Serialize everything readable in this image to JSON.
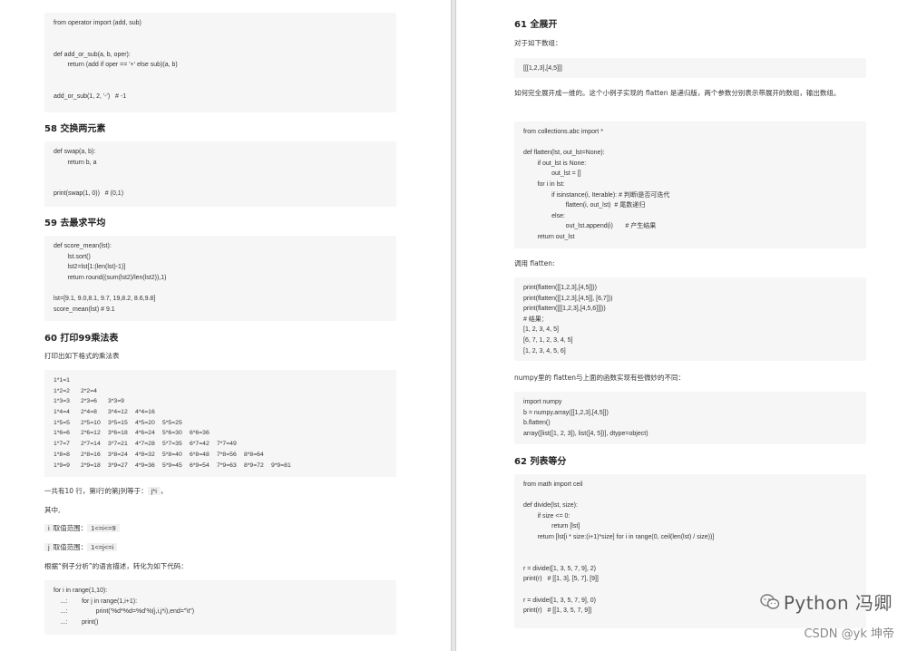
{
  "left": {
    "code_top": [
      "from operator import (add, sub)",
      "",
      "",
      "def add_or_sub(a, b, oper):",
      "        return (add if oper == '+' else sub)(a, b)",
      "",
      "",
      "add_or_sub(1, 2, '-')   # -1"
    ],
    "h58": "58 交换两元素",
    "code58": [
      "def swap(a, b):",
      "        return b, a",
      "",
      "",
      "print(swap(1, 0))   # (0,1)"
    ],
    "h59": "59 去最求平均",
    "code59": [
      "def score_mean(lst):",
      "        lst.sort()",
      "        lst2=lst[1:(len(lst)-1)]",
      "        return round((sum(lst2)/len(lst2)),1)",
      "",
      "lst=[9.1, 9.0,8.1, 9.7, 19,8.2, 8.6,9.8]",
      "score_mean(lst) # 9.1"
    ],
    "h60": "60 打印99乘法表",
    "p60": "打印出如下格式的乘法表",
    "table_rows": [
      [
        "1*1=1"
      ],
      [
        "1*2=2",
        "2*2=4"
      ],
      [
        "1*3=3",
        "2*3=6",
        "3*3=9"
      ],
      [
        "1*4=4",
        "2*4=8",
        "3*4=12",
        "4*4=16"
      ],
      [
        "1*5=5",
        "2*5=10",
        "3*5=15",
        "4*5=20",
        "5*5=25"
      ],
      [
        "1*6=6",
        "2*6=12",
        "3*6=18",
        "4*6=24",
        "5*6=30",
        "6*6=36"
      ],
      [
        "1*7=7",
        "2*7=14",
        "3*7=21",
        "4*7=28",
        "5*7=35",
        "6*7=42",
        "7*7=49"
      ],
      [
        "1*8=8",
        "2*8=16",
        "3*8=24",
        "4*8=32",
        "5*8=40",
        "6*8=48",
        "7*8=56",
        "8*8=64"
      ],
      [
        "1*9=9",
        "2*9=18",
        "3*9=27",
        "4*9=36",
        "5*9=45",
        "6*9=54",
        "7*9=63",
        "8*9=72",
        "9*9=81"
      ]
    ],
    "p_rows_prefix": "一共有10 行，第i行的第j列等于：",
    "p_rows_code": "j*i",
    "p_rows_suffix": "，",
    "p_where": "其中,",
    "p_i_prefix": "i",
    "p_i_mid": "取值范围：",
    "p_i_code": "1<=i<=9",
    "p_j_prefix": "j",
    "p_j_mid": "取值范围：",
    "p_j_code": "1<=j<=i",
    "p_analysis": "根据“例子分析”的语言描述，转化为如下代码：",
    "code_bottom": [
      "for i in range(1,10):",
      "    ...:        for j in range(1,i+1):",
      "    ...:                print('%d*%d=%d'%(j,i,j*i),end=\"\\t\")",
      "    ...:        print()"
    ]
  },
  "right": {
    "h61": "61 全展开",
    "p61a": "对于如下数组：",
    "arr": "[[[1,2,3],[4,5]]]",
    "p61b": "如何完全展开成一维的。这个小例子实现的 flatten 是递归版，两个参数分别表示带展开的数组，输出数组。",
    "code61": [
      "from collections.abc import *",
      "",
      "def flatten(lst, out_lst=None):",
      "        if out_lst is None:",
      "                out_lst = []",
      "        for i in lst:",
      "                if isinstance(i, Iterable): # 判断i是否可迭代",
      "                        flatten(i, out_lst)  # 尾数递归",
      "                else:",
      "                        out_lst.append(i)       # 产生结果",
      "        return out_lst"
    ],
    "p_call": "调用 flatten:",
    "code_call": [
      "print(flatten([[1,2,3],[4,5]]))",
      "print(flatten([[1,2,3],[4,5]], [6,7]))",
      "print(flatten([[[1,2,3],[4,5,6]]]))",
      "# 结果：",
      "[1, 2, 3, 4, 5]",
      "[6, 7, 1, 2, 3, 4, 5]",
      "[1, 2, 3, 4, 5, 6]"
    ],
    "p_numpy": "numpy里的 flatten与上面的函数实现有些微妙的不同：",
    "code_numpy": [
      "import numpy",
      "b = numpy.array([[1,2,3],[4,5]])",
      "b.flatten()",
      "array([list([1, 2, 3]), list([4, 5])], dtype=object)"
    ],
    "h62": "62 列表等分",
    "code62": [
      "from math import ceil",
      "",
      "def divide(lst, size):",
      "        if size <= 0:",
      "                return [lst]",
      "        return [lst[i * size:(i+1)*size] for i in range(0, ceil(len(lst) / size))]",
      "",
      "",
      "r = divide([1, 3, 5, 7, 9], 2)",
      "print(r)   # [[1, 3], [5, 7], [9]]",
      "",
      "r = divide([1, 3, 5, 7, 9], 0)",
      "print(r)   # [[1, 3, 5, 7, 9]]"
    ]
  },
  "watermark": {
    "text": "Python 冯卿",
    "icon": "wechat-icon",
    "csdn": "CSDN @yk 坤帝"
  },
  "colors": {
    "code_bg": "#f6f6f6",
    "keyword": "#7a2ea8",
    "function": "#1f6fb8",
    "comment": "#c2762c"
  }
}
